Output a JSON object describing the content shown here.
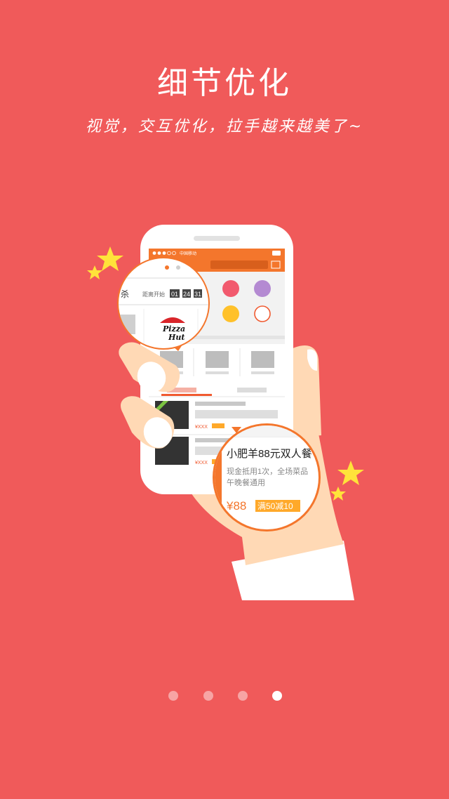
{
  "header": {
    "title": "细节优化",
    "subtitle": "视觉，交互优化，拉手越来越美了~"
  },
  "phone": {
    "carrier": "中国移动",
    "deal_price_label": "¥XXX"
  },
  "zoom_top": {
    "label_seckill": "杀",
    "countdown_label": "距离开始",
    "countdown": [
      "01",
      "24",
      "31"
    ],
    "brand_line1": "Pizza",
    "brand_line2": "Hut"
  },
  "zoom_bottom": {
    "deal_title": "小肥羊88元双人餐",
    "deal_desc_line1": "现金抵用1次，全场菜品",
    "deal_desc_line2": "午晚餐通用",
    "price": "¥88",
    "promo_badge": "满50减10"
  },
  "pagination": {
    "count": 4,
    "active_index": 3
  },
  "colors": {
    "background": "#f05a5a",
    "accent": "#f4762c",
    "star": "#ffe33a"
  }
}
